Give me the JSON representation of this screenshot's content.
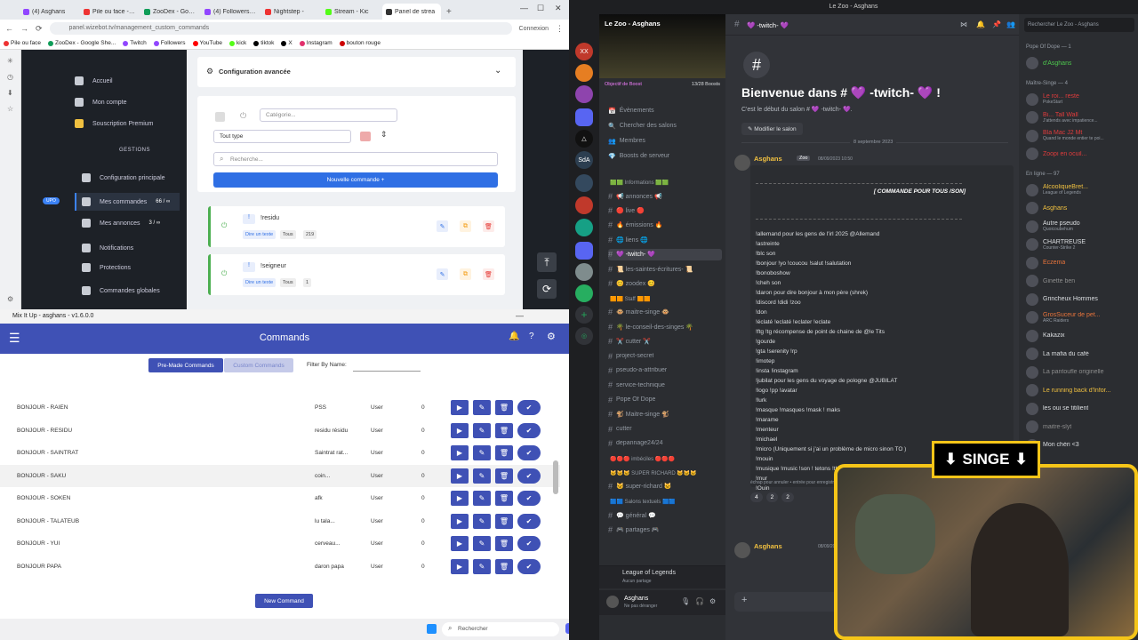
{
  "browser": {
    "tabs": [
      {
        "label": "(4) Asghans",
        "color": "#9146ff"
      },
      {
        "label": "Pile ou face - la",
        "color": "#e33"
      },
      {
        "label": "ZooDex - Googl",
        "color": "#0f9d58"
      },
      {
        "label": "(4) Followers - T",
        "color": "#9146ff"
      },
      {
        "label": "Nightstep -",
        "color": "#e33"
      },
      {
        "label": "Stream - Kic",
        "color": "#53fc18"
      },
      {
        "label": "Panel de strea",
        "color": "#333"
      }
    ],
    "url": "panel.wizebot.tv/management_custom_commands",
    "profile": "Connexion",
    "bookmarks": [
      "Pile ou face",
      "ZooDex - Google She...",
      "Twitch",
      "Followers",
      "YouTube",
      "kick",
      "tiktok",
      "X",
      "Instagram",
      "bouton rouge"
    ],
    "sidebar": {
      "items": [
        "Accueil",
        "Mon compte",
        "Souscription Premium",
        "GESTIONS",
        "Configuration principale",
        "Mes commandes",
        "Mes annonces",
        "Notifications",
        "Protections",
        "Commandes globales"
      ],
      "commands_count": "66 / ∞",
      "announces_count": "3 / ∞",
      "badge": "UPO"
    },
    "panel": {
      "section_title": "Configuration avancée",
      "category_placeholder": "Catégorie...",
      "type_select": "Tout type",
      "search_placeholder": "Recherche...",
      "new_command": "Nouvelle commande",
      "commands": [
        {
          "name": "!residu",
          "tag": "Dire un texte",
          "role": "Tous",
          "count": "219"
        },
        {
          "name": "!seigneur",
          "tag": "Dire un texte",
          "role": "Tous",
          "count": "1"
        }
      ]
    }
  },
  "mixitup": {
    "window_title": "Mix It Up - asghans - v1.6.0.0",
    "header_title": "Commands",
    "tab_premade": "Pre-Made Commands",
    "tab_custom": "Custom Commands",
    "filter_label": "Filter By Name:",
    "rows": [
      {
        "name": "BONJOUR - RAIEN",
        "text": "PSS",
        "role": "User",
        "cd": "0"
      },
      {
        "name": "BONJOUR - RESIDU",
        "text": "residu résidu",
        "role": "User",
        "cd": "0"
      },
      {
        "name": "BONJOUR - SAINTRAT",
        "text": "Saintrat rat...",
        "role": "User",
        "cd": "0"
      },
      {
        "name": "BONJOUR - SAKU",
        "text": "coin...",
        "role": "User",
        "cd": "0"
      },
      {
        "name": "BONJOUR - SOKEN",
        "text": "afk",
        "role": "User",
        "cd": "0"
      },
      {
        "name": "BONJOUR - TALATEUB",
        "text": "lu tala...",
        "role": "User",
        "cd": "0"
      },
      {
        "name": "BONJOUR - YUI",
        "text": "cerveau...",
        "role": "User",
        "cd": "0"
      },
      {
        "name": "BONJOUR PAPA",
        "text": "daron papa",
        "role": "User",
        "cd": "0"
      }
    ],
    "new_command": "New Command"
  },
  "taskbar": {
    "search": "Rechercher"
  },
  "discord": {
    "window_title": "Le Zoo - Asghans",
    "server_name": "Le Zoo - Asghans",
    "boost_label": "Objectif de Boost",
    "boost_count": "13/28 Boosts",
    "nav": [
      "Évènements",
      "Chercher des salons",
      "Membres",
      "Boosts de serveur"
    ],
    "channels": [
      {
        "type": "cat",
        "label": "🟩🟩 Informations 🟩🟩"
      },
      {
        "type": "ch",
        "label": "📢 annonces 📢"
      },
      {
        "type": "ch",
        "label": "🔴 live 🔴"
      },
      {
        "type": "ch",
        "label": "🔥 émissions 🔥"
      },
      {
        "type": "ch",
        "label": "🌐 liens 🌐"
      },
      {
        "type": "sel",
        "label": "💜 -twitch- 💜"
      },
      {
        "type": "ch",
        "label": "📜 les-saintes-écritures- 📜"
      },
      {
        "type": "ch",
        "label": "😊 zoodex 😊"
      },
      {
        "type": "cat",
        "label": "🟧🟧 Staff 🟧🟧"
      },
      {
        "type": "ch",
        "label": "🐵 maitre-singe 🐵"
      },
      {
        "type": "ch",
        "label": "🌴 le-conseil-des-singes 🌴"
      },
      {
        "type": "ch",
        "label": "✂️ cutter ✂️"
      },
      {
        "type": "ch",
        "label": "project-secret"
      },
      {
        "type": "ch",
        "label": "pseudo-a-attribuer"
      },
      {
        "type": "ch",
        "label": "service-technique"
      },
      {
        "type": "ch",
        "label": "Pope Of Dope"
      },
      {
        "type": "ch",
        "label": "🐒 Maitre-singe 🐒"
      },
      {
        "type": "ch",
        "label": "cutter"
      },
      {
        "type": "ch",
        "label": "depannage24/24"
      },
      {
        "type": "cat",
        "label": "🔴🔴🔴 imbéciles 🔴🔴🔴"
      },
      {
        "type": "cat",
        "label": "🐱🐱🐱 SUPER RICHARD 🐱🐱🐱"
      },
      {
        "type": "ch",
        "label": "🐱 super-richard 🐱"
      },
      {
        "type": "cat",
        "label": "🟦🟦 Salons textuels 🟦🟦"
      },
      {
        "type": "ch",
        "label": "💬 général 💬"
      },
      {
        "type": "ch",
        "label": "🎮 partages 🎮"
      }
    ],
    "voice_status": "League of Legends",
    "voice_sub": "Aucun partage",
    "user_name": "Asghans",
    "user_status": "Ne pas déranger",
    "channel_header": "💜 -twitch- 💜",
    "search_placeholder": "Rechercher Le Zoo - Asghans",
    "welcome_title": "Bienvenue dans # 💜 -twitch- 💜 !",
    "welcome_sub": "C'est le début du salon # 💜 -twitch- 💜.",
    "edit_channel": "Modifier le salon",
    "date_divider": "8 septembre 2023",
    "msg_author": "Asghans",
    "msg_tag": "Zoo",
    "msg_time": "08/09/2023 10:50",
    "embed_title": "[ COMMANDE POUR TOUS /SON]",
    "embed_lines": [
      "!allemand pour les gens de l'irl 2025 @Allemand",
      "!astreinte",
      "!blc son",
      "!bonjour !yo !coucou !salut !salutation",
      "!bonoboshow",
      "!cheh son",
      "!daron pour dire bonjour à mon père (shrek)",
      "!discord !didi !zoo",
      "!don",
      "!éclaté !eclaté !eclater !eclate",
      "!ftg !tg récompense de point de chaine de @le Tits",
      "!gourde",
      "!gta !serenity !rp",
      "!imotep",
      "!insta !instagram",
      "!jubilat pour les gens du voyage de pologne @JUBILAT",
      "!logo !pp !avatar",
      "!lurk",
      "!masque !masques !mask ! maks",
      "!marame",
      "!menteur",
      "!michael",
      "!micro (Uniquement si j'ai un problème de micro sinon TO )",
      "!mouin",
      "!musique !music !son ! tetons !thaehan !teton",
      "!mur",
      "!Ouin"
    ],
    "embed_footer": "échap pour annuler • entrée pour enregistrer",
    "reactions": [
      "4",
      "2",
      "2"
    ],
    "msg2_author": "Asghans",
    "msg2_time": "08/09/2023 10:51",
    "members_groups": [
      {
        "title": "Pope Of Dope — 1",
        "members": [
          {
            "name": "d'Asghans",
            "color": "#4ec94e",
            "sub": ""
          }
        ]
      },
      {
        "title": "Maître-Singe — 4",
        "members": [
          {
            "name": "Le roi... reste",
            "color": "#e03c3c",
            "sub": "PokeStart"
          },
          {
            "name": "Bi... Tall Wall",
            "color": "#e03c3c",
            "sub": "J'attends avec impatience..."
          },
          {
            "name": "Bla Mac J2 Mt",
            "color": "#e03c3c",
            "sub": "Quand le monde entier te poi..."
          },
          {
            "name": "Zoopi en ocuil...",
            "color": "#e03c3c",
            "sub": ""
          }
        ]
      },
      {
        "title": "En ligne — 97",
        "members": [
          {
            "name": "AlcooliqueBret...",
            "color": "#f0c040",
            "sub": "League of Legends"
          },
          {
            "name": "Asghans",
            "color": "#f0c040",
            "sub": ""
          },
          {
            "name": "Autre pseudo",
            "color": "#dbdee1",
            "sub": "Quoicoubehum"
          },
          {
            "name": "CHARTREUSE",
            "color": "#dbdee1",
            "sub": "Counter-Strike 2"
          },
          {
            "name": "Eczema",
            "color": "#e8743b",
            "sub": ""
          },
          {
            "name": "Ginette ben",
            "color": "#8c8c8c",
            "sub": ""
          },
          {
            "name": "Grincheux Hommes",
            "color": "#dbdee1",
            "sub": ""
          },
          {
            "name": "GrosSuceur de pet...",
            "color": "#e8743b",
            "sub": "ARC Raiders"
          },
          {
            "name": "Kakazix",
            "color": "#dbdee1",
            "sub": ""
          },
          {
            "name": "La mafia du café",
            "color": "#dbdee1",
            "sub": ""
          },
          {
            "name": "La pantoufle originelle",
            "color": "#8c8c8c",
            "sub": ""
          },
          {
            "name": "Le running back d'Infor...",
            "color": "#f0c040",
            "sub": ""
          },
          {
            "name": "les oui se titilient",
            "color": "#dbdee1",
            "sub": ""
          },
          {
            "name": "maitre-slyt",
            "color": "#8c8c8c",
            "sub": ""
          },
          {
            "name": "Mon chéri <3",
            "color": "#dbdee1",
            "sub": ""
          }
        ]
      }
    ]
  },
  "overlay": {
    "label": "SINGE"
  }
}
